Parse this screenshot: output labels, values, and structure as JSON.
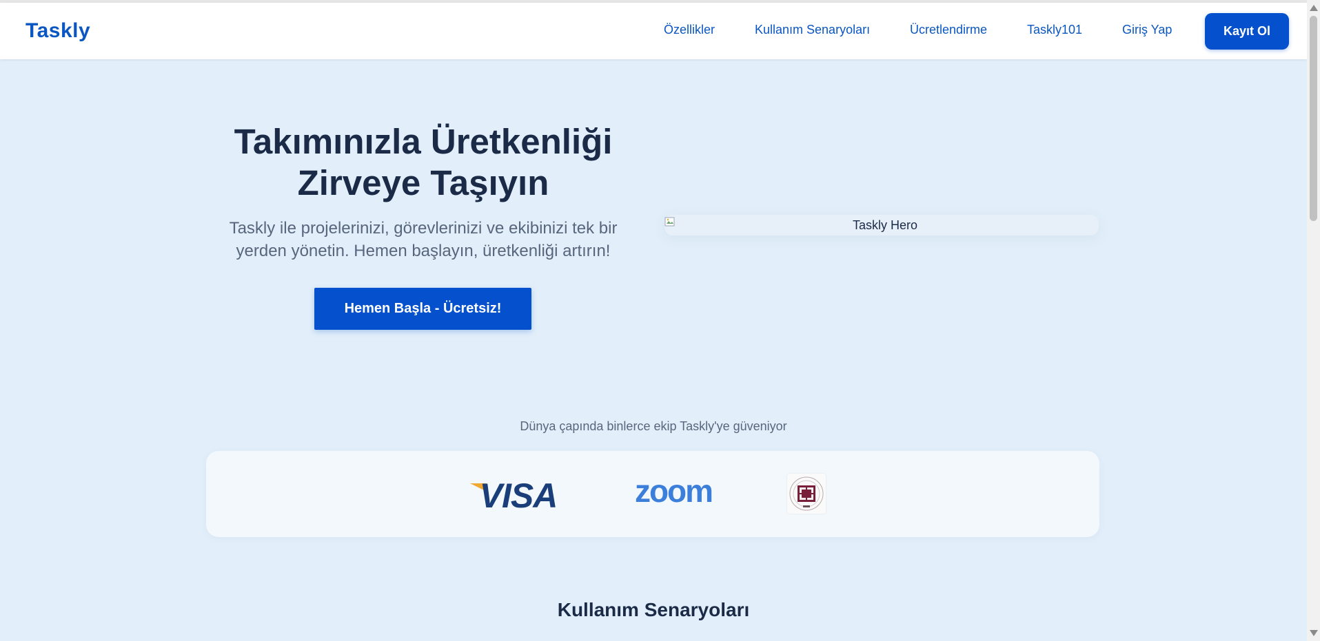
{
  "nav": {
    "brand": "Taskly",
    "links": [
      "Özellikler",
      "Kullanım Senaryoları",
      "Ücretlendirme",
      "Taskly101",
      "Giriş Yap"
    ],
    "signup_label": "Kayıt Ol"
  },
  "hero": {
    "title_line1": "Takımınızla Üretkenliği",
    "title_line2": "Zirveye Taşıyın",
    "subtitle_line1": "Taskly ile projelerinizi, görevlerinizi ve ekibinizi tek bir",
    "subtitle_line2": "yerden yönetin. Hemen başlayın, üretkenliği artırın!",
    "cta_label": "Hemen Başla - Ücretsiz!",
    "image_alt": "Taskly Hero"
  },
  "trust": {
    "text": "Dünya çapında binlerce ekip Taskly'ye güveniyor",
    "logos": [
      "VISA",
      "zoom",
      "university-seal"
    ]
  },
  "sections": {
    "use_cases_title": "Kullanım Senaryoları"
  },
  "colors": {
    "brand_blue": "#0550cd",
    "link_blue": "#0a56c2",
    "page_bg": "#e2effa",
    "heading": "#1b2a47",
    "muted": "#57667d"
  }
}
